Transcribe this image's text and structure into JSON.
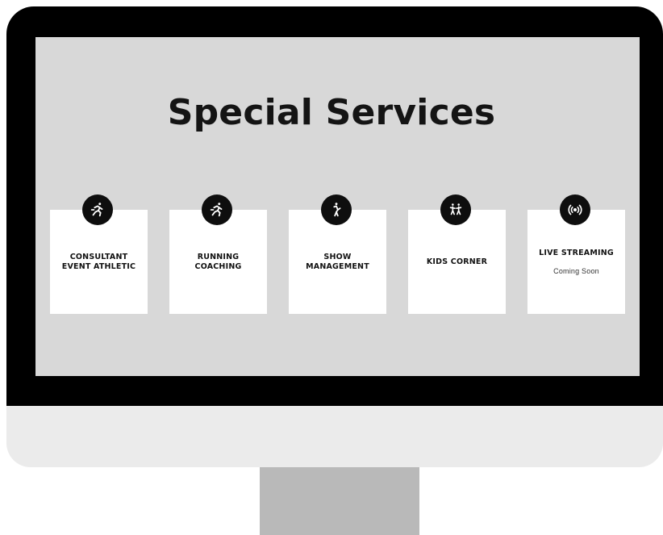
{
  "page": {
    "title": "Special Services"
  },
  "services": [
    {
      "lines": [
        "CONSULTANT",
        "EVENT ATHLETIC"
      ],
      "icon": "runner-icon",
      "subtitle": ""
    },
    {
      "lines": [
        "RUNNING",
        "COACHING"
      ],
      "icon": "runner-icon",
      "subtitle": ""
    },
    {
      "lines": [
        "SHOW",
        "MANAGEMENT"
      ],
      "icon": "performer-icon",
      "subtitle": ""
    },
    {
      "lines": [
        "KIDS CORNER"
      ],
      "icon": "kids-icon",
      "subtitle": ""
    },
    {
      "lines": [
        "LIVE STREAMING"
      ],
      "icon": "broadcast-icon",
      "subtitle": "Coming Soon"
    }
  ],
  "colors": {
    "screen": "#d8d8d8",
    "bezel": "#000000",
    "card": "#ffffff",
    "badge": "#0e0e0e"
  }
}
